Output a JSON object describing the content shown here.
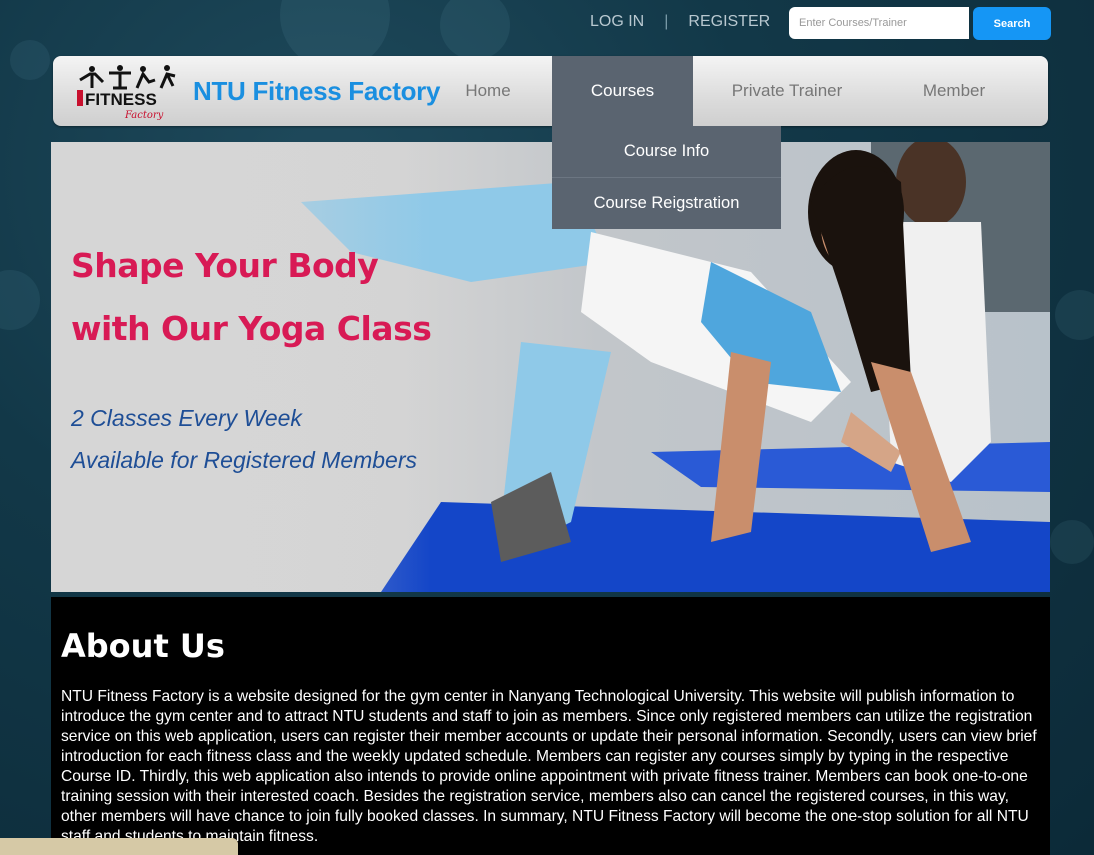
{
  "top_bar": {
    "login": "LOG IN",
    "separator": "|",
    "register": "REGISTER",
    "search_placeholder": "Enter Courses/Trainer",
    "search_button": "Search"
  },
  "brand": {
    "logo_text": "NTU FITNESS Factory",
    "name": "NTU Fitness Factory"
  },
  "nav": {
    "items": [
      {
        "label": "Home"
      },
      {
        "label": "Courses",
        "active": true
      },
      {
        "label": "Private Trainer"
      },
      {
        "label": "Member"
      }
    ],
    "dropdown": [
      "Course Info",
      "Course Reigstration"
    ]
  },
  "hero": {
    "title_line1": "Shape Your Body",
    "title_line2": "with Our Yoga Class",
    "sub_line1": "2 Classes Every Week",
    "sub_line2": "Available for Registered Members"
  },
  "about": {
    "heading": "About Us",
    "body": "NTU Fitness Factory is a website designed for the gym center in Nanyang Technological University. This website will publish information to introduce the gym center and to attract NTU students and staff to join as members. Since only registered members can utilize the registration service on this web application, users can register their member accounts or update their personal information. Secondly, users can view brief introduction for each fitness class and the weekly updated schedule. Members can register any courses simply by typing in the respective Course ID. Thirdly, this web application also intends to provide online appointment with private fitness trainer. Members can book one-to-one training session with their interested coach. Besides the registration service, members also can cancel the registered courses, in this way, other members will have chance to join fully booked classes. In summary, NTU Fitness Factory will become the one-stop solution for all NTU staff and students to maintain fitness."
  },
  "colors": {
    "brand_blue": "#1a8fe0",
    "hero_pink": "#d81a55",
    "hero_blue": "#1e4e96",
    "nav_active": "#5a6470",
    "search_blue": "#1596f5"
  }
}
